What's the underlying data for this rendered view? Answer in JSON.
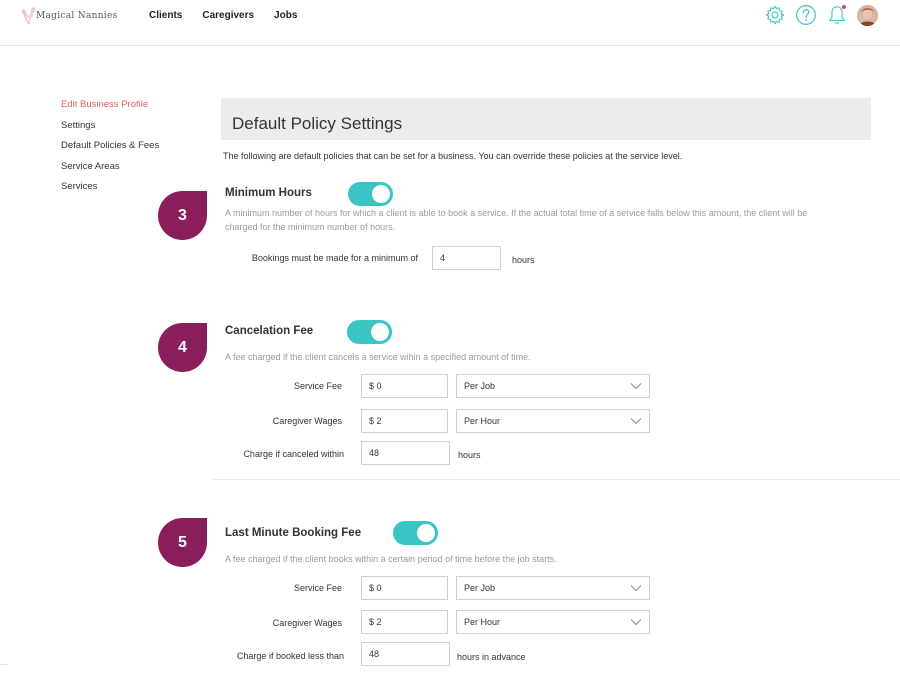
{
  "app": {
    "brand": "Magical Nannies",
    "nav": [
      "Clients",
      "Caregivers",
      "Jobs"
    ],
    "accent": "#3bc4c4",
    "badge_color": "#8a1d5c",
    "active_link_color": "#e25b5b",
    "icons": [
      "gear-icon",
      "help-icon",
      "bell-icon",
      "avatar"
    ]
  },
  "sidebar": {
    "items": [
      {
        "label": "Edit Business Profile",
        "active": true
      },
      {
        "label": "Settings"
      },
      {
        "label": "Default Policies & Fees"
      },
      {
        "label": "Service Areas"
      },
      {
        "label": "Services"
      }
    ]
  },
  "page": {
    "title": "Default Policy Settings",
    "intro": "The following are default policies that can be set for a business. You can override these policies at the service level."
  },
  "sections": {
    "min_hours": {
      "badge": "3",
      "title": "Minimum Hours",
      "enabled": true,
      "description": "A minimum number of hours for which a client is able to book a service. If the actual total time of a service falls below this amount, the client will be charged for the minimum number of hours.",
      "label": "Bookings must be made for a minimum of",
      "value": "4",
      "unit": "hours"
    },
    "cancel_fee": {
      "badge": "4",
      "title": "Cancelation Fee",
      "enabled": true,
      "description": "A fee charged if the client cancels a service wihin a specified amount of time.",
      "service_fee_label": "Service Fee",
      "service_fee_value": "$ 0",
      "service_fee_basis": "Per Job",
      "wages_label": "Caregiver Wages",
      "wages_value": "$ 2",
      "wages_basis": "Per Hour",
      "window_label": "Charge if canceled within",
      "window_value": "48",
      "window_unit": "hours"
    },
    "last_minute": {
      "badge": "5",
      "title": "Last Minute Booking Fee",
      "enabled": true,
      "description": "A fee charged if the client books within a certain period of time before the job starts.",
      "service_fee_label": "Service Fee",
      "service_fee_value": "$ 0",
      "service_fee_basis": "Per Job",
      "wages_label": "Caregiver Wages",
      "wages_value": "$ 2",
      "wages_basis": "Per Hour",
      "window_label": "Charge if booked less than",
      "window_value": "48",
      "window_unit": "hours in advance"
    }
  }
}
